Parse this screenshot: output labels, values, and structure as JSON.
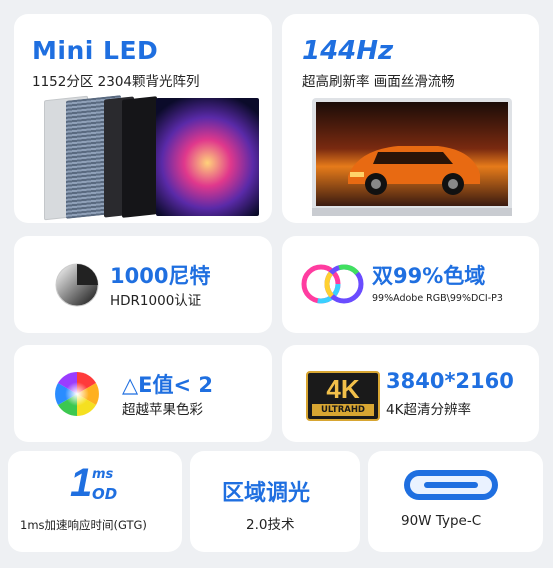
{
  "cards": {
    "miniled": {
      "title": "Mini LED",
      "subtitle": "1152分区 2304颗背光阵列"
    },
    "refresh": {
      "title": "144Hz",
      "subtitle": "超高刷新率 画面丝滑流畅"
    },
    "brightness": {
      "title": "1000尼特",
      "subtitle": "HDR1000认证"
    },
    "gamut": {
      "title": "双99%色域",
      "subtitle": "99%Adobe RGB\\99%DCI-P3"
    },
    "delta_e": {
      "title": "△E值< 2",
      "subtitle": "超越苹果色彩"
    },
    "resolution": {
      "badge_main": "4K",
      "badge_sub": "ULTRAHD",
      "title": "3840*2160",
      "subtitle": "4K超清分辨率"
    },
    "response": {
      "logo_main": "1",
      "logo_ms": "ms",
      "logo_od": "OD",
      "subtitle": "1ms加速响应时间(GTG)"
    },
    "dimming": {
      "title": "区域调光",
      "subtitle": "2.0技术"
    },
    "usbc": {
      "subtitle": "90W Type-C"
    }
  },
  "colors": {
    "accent": "#1f6fe0",
    "text": "#222222",
    "background": "#eef0f3",
    "card": "#ffffff"
  }
}
